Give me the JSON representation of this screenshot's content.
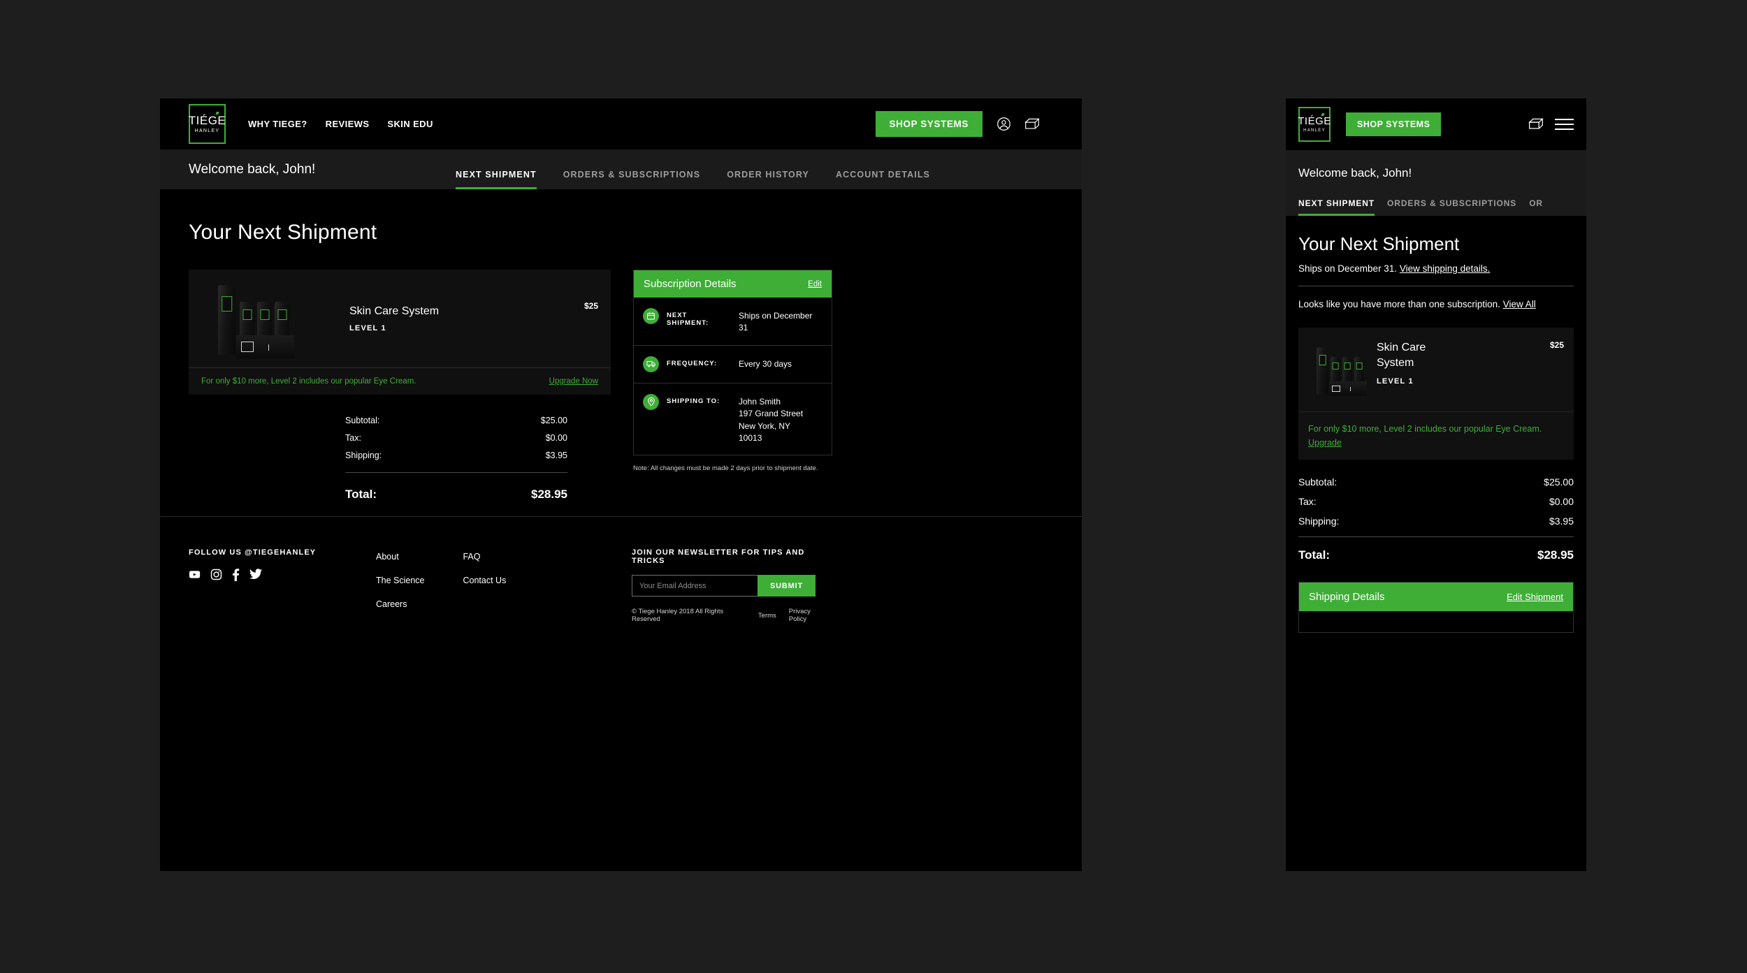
{
  "brand": {
    "logo_top": "TIÉGE",
    "logo_bottom": "HANLEY",
    "accent_green": "#3fae37",
    "background": "#000000",
    "page_background": "#1e1e1e"
  },
  "desktop": {
    "header": {
      "nav": [
        {
          "label": "WHY TIEGE?"
        },
        {
          "label": "REVIEWS"
        },
        {
          "label": "SKIN EDU"
        }
      ],
      "shop_button": "SHOP SYSTEMS",
      "account_icon": "account-icon",
      "box_icon": "box-icon"
    },
    "subnav": {
      "welcome": "Welcome back, John!",
      "tabs": [
        {
          "label": "NEXT SHIPMENT",
          "active": true
        },
        {
          "label": "ORDERS & SUBSCRIPTIONS",
          "active": false
        },
        {
          "label": "ORDER HISTORY",
          "active": false
        },
        {
          "label": "ACCOUNT DETAILS",
          "active": false
        }
      ]
    },
    "page_title": "Your Next Shipment",
    "product": {
      "name": "Skin Care System",
      "level": "LEVEL 1",
      "price": "$25",
      "upsell_text": "For only $10 more, Level 2 includes our popular Eye Cream.",
      "upsell_link": "Upgrade Now"
    },
    "totals": {
      "rows": [
        {
          "label": "Subtotal:",
          "value": "$25.00"
        },
        {
          "label": "Tax:",
          "value": "$0.00"
        },
        {
          "label": "Shipping:",
          "value": "$3.95"
        }
      ],
      "total_label": "Total:",
      "total_value": "$28.95"
    },
    "subscription": {
      "title": "Subscription Details",
      "edit_link": "Edit",
      "rows": [
        {
          "icon": "calendar-icon",
          "label": "NEXT SHIPMENT:",
          "value": "Ships on December 31"
        },
        {
          "icon": "truck-icon",
          "label": "FREQUENCY:",
          "value": "Every 30 days"
        },
        {
          "icon": "map-pin-icon",
          "label": "SHIPPING TO:",
          "value": "John Smith\n197 Grand Street\nNew York, NY\n10013"
        }
      ],
      "note": "Note: All changes must be made 2 days prior to shipment date."
    },
    "footer": {
      "social_heading": "FOLLOW US @TIEGEHANLEY",
      "socials": [
        {
          "name": "youtube-icon"
        },
        {
          "name": "instagram-icon"
        },
        {
          "name": "facebook-icon"
        },
        {
          "name": "twitter-icon"
        }
      ],
      "links_col1": [
        {
          "label": "About"
        },
        {
          "label": "The Science"
        },
        {
          "label": "Careers"
        }
      ],
      "links_col2": [
        {
          "label": "FAQ"
        },
        {
          "label": "Contact Us"
        }
      ],
      "newsletter_heading": "JOIN OUR NEWSLETTER FOR TIPS AND TRICKS",
      "email_placeholder": "Your Email Address",
      "email_value": "",
      "submit_label": "SUBMIT",
      "copyright": "© Tiege Hanley 2018 All Rights Reserved",
      "terms": "Terms",
      "privacy": "Privacy Policy"
    }
  },
  "mobile": {
    "header": {
      "shop_button": "SHOP SYSTEMS",
      "box_icon": "box-icon",
      "menu_icon": "hamburger-menu-icon"
    },
    "welcome": "Welcome back, John!",
    "tabs": [
      {
        "label": "NEXT SHIPMENT",
        "active": true
      },
      {
        "label": "ORDERS & SUBSCRIPTIONS",
        "active": false
      },
      {
        "label": "OR",
        "active": false
      }
    ],
    "page_title": "Your Next Shipment",
    "ships_text": "Ships on December 31.",
    "ships_link": "View shipping details.",
    "multi_text": "Looks like you have more than one subscription.",
    "multi_link": "View All",
    "product": {
      "name": "Skin Care System",
      "level": "LEVEL 1",
      "price": "$25",
      "upsell_text": "For only $10 more, Level 2 includes our popular Eye Cream.",
      "upsell_link": "Upgrade"
    },
    "totals": {
      "rows": [
        {
          "label": "Subtotal:",
          "value": "$25.00"
        },
        {
          "label": "Tax:",
          "value": "$0.00"
        },
        {
          "label": "Shipping:",
          "value": "$3.95"
        }
      ],
      "total_label": "Total:",
      "total_value": "$28.95"
    },
    "shipping_panel": {
      "title": "Shipping Details",
      "edit_link": "Edit Shipment"
    }
  }
}
